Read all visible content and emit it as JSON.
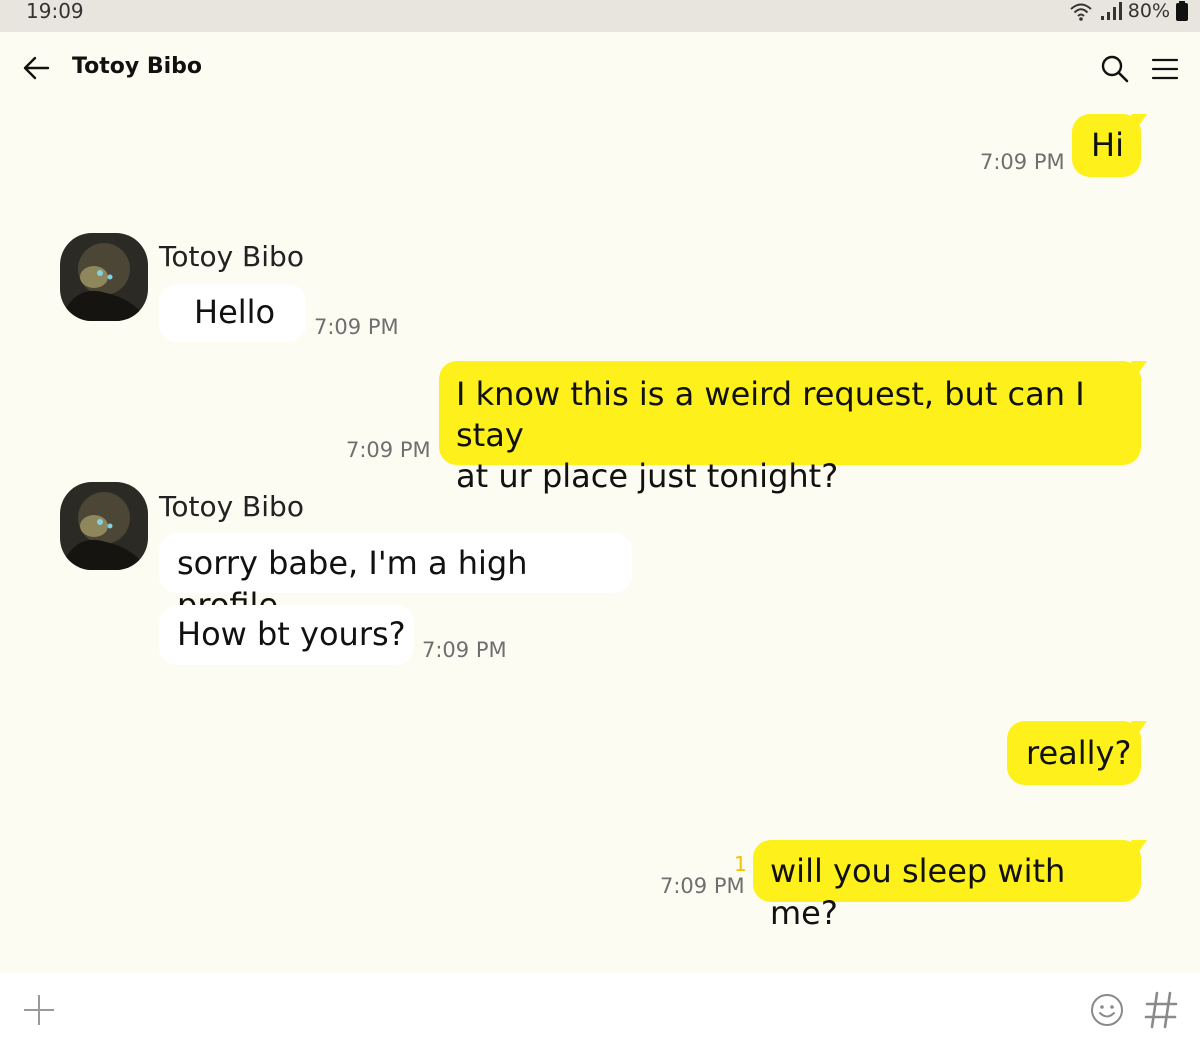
{
  "status_bar": {
    "time": "19:09",
    "battery": "80%"
  },
  "header": {
    "title": "Totoy Bibo"
  },
  "messages": [
    {
      "sender": "me",
      "text": "Hi",
      "time": "7:09 PM"
    },
    {
      "sender": "them",
      "name": "Totoy Bibo",
      "text": "Hello",
      "time": "7:09 PM"
    },
    {
      "sender": "me",
      "line1": "I know this is a weird request, but can I stay",
      "line2": "at ur place just tonight?",
      "time": "7:09 PM"
    },
    {
      "sender": "them",
      "name": "Totoy Bibo",
      "text": "sorry babe, I'm a high profile"
    },
    {
      "sender": "them",
      "text": "How bt yours?",
      "time": "7:09 PM"
    },
    {
      "sender": "me",
      "text": "really?"
    },
    {
      "sender": "me",
      "text": "will you sleep with me?",
      "time": "7:09 PM",
      "unread": "1"
    }
  ],
  "colors": {
    "my_bubble": "#fef01b",
    "their_bubble": "#ffffff",
    "background": "#fdfcf2"
  },
  "icons": [
    "back-arrow-icon",
    "search-icon",
    "menu-icon",
    "plus-icon",
    "emoji-icon",
    "hashtag-icon",
    "wifi-icon",
    "signal-icon",
    "battery-icon"
  ]
}
